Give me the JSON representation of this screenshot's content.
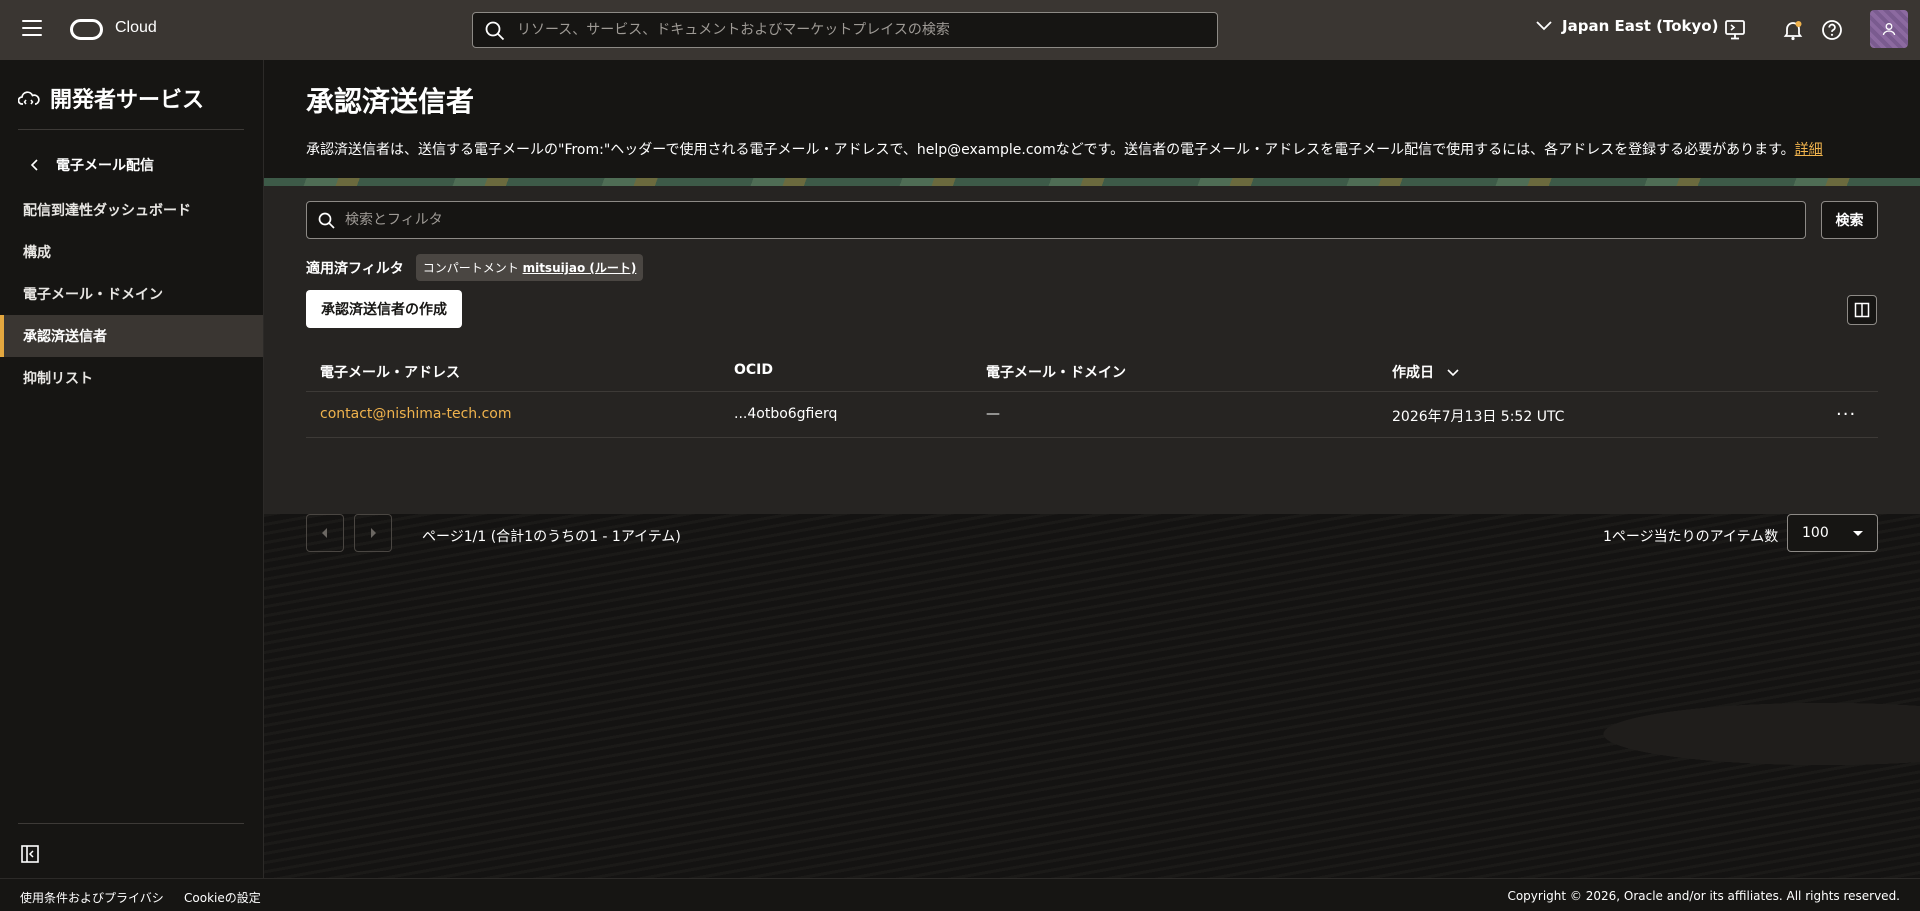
{
  "topbar": {
    "brand": "Cloud",
    "search_placeholder": "リソース、サービス、ドキュメントおよびマーケットプレイスの検索",
    "region": "Japan East (Tokyo)"
  },
  "sidebar": {
    "title": "開発者サービス",
    "back_label": "電子メール配信",
    "items": [
      {
        "label": "配信到達性ダッシュボード"
      },
      {
        "label": "構成"
      },
      {
        "label": "電子メール・ドメイン"
      },
      {
        "label": "承認済送信者"
      },
      {
        "label": "抑制リスト"
      }
    ]
  },
  "main": {
    "title": "承認済送信者",
    "description": "承認済送信者は、送信する電子メールの\"From:\"ヘッダーで使用される電子メール・アドレスで、help@example.comなどです。送信者の電子メール・アドレスを電子メール配信で使用するには、各アドレスを登録する必要があります。",
    "details_link": "詳細",
    "filter_placeholder": "検索とフィルタ",
    "search_button": "検索",
    "applied_filters_label": "適用済フィルタ",
    "chip_prefix": "コンパートメント",
    "chip_value": "mitsuijao (ルート)",
    "create_button": "承認済送信者の作成",
    "table": {
      "headers": [
        "電子メール・アドレス",
        "OCID",
        "電子メール・ドメイン",
        "作成日"
      ],
      "rows": [
        {
          "email": "contact@nishima-tech.com",
          "ocid": "...4otbo6gfierq",
          "domain": "—",
          "created": "2026年7月13日 5:52 UTC"
        }
      ]
    },
    "pagination_text": "ページ1/1 (合計1のうちの1 - 1アイテム)",
    "per_page_label": "1ページ当たりのアイテム数",
    "per_page_value": "100"
  },
  "footer": {
    "terms": "使用条件およびプライバシ",
    "cookies": "Cookieの設定",
    "copyright": "Copyright © 2026, Oracle and/or its affiliates. All rights reserved."
  },
  "colors": {
    "topbar": "#3a3632",
    "background": "#161513",
    "panel": "#262422",
    "link": "#f0b34d",
    "active_indicator": "#e3a73f"
  },
  "icons": [
    "hamburger-icon",
    "oracle-logo-icon",
    "search-icon",
    "chevron-down-icon",
    "cloud-shell-icon",
    "bell-icon",
    "help-icon",
    "user-icon",
    "developer-services-icon",
    "chevron-left-icon",
    "collapse-sidebar-icon",
    "columns-icon",
    "kebab-icon",
    "sort-chevron-icon",
    "prev-page-icon",
    "next-page-icon"
  ]
}
